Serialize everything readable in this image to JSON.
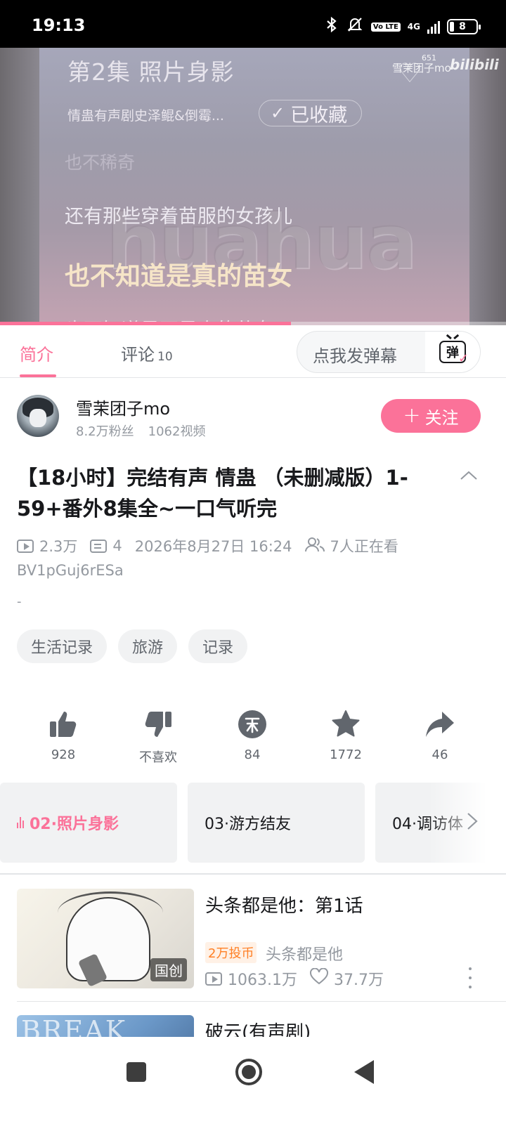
{
  "status_bar": {
    "time": "19:13",
    "icons": [
      "bluetooth-icon",
      "mute-icon",
      "volte-icon",
      "4g-icon",
      "signal-icon",
      "battery-icon"
    ],
    "volte": "Vo LTE",
    "network": "4G",
    "battery": "8"
  },
  "player": {
    "episode_title": "第2集 照片身影",
    "series_name": "情蛊有声剧史泽鲲&倒霉...",
    "favorite_label": "已收藏",
    "watermark_user": "雪茉团子mo",
    "watermark_logo": "bilibili",
    "watermark_count": "651",
    "lyric_prev2": "也不稀奇",
    "lyric_prev1": "还有那些穿着苗服的女孩儿",
    "lyric_current": "也不知道是真的苗女",
    "lyric_next": "也不知道是不是真的苗女",
    "overlay_text": "huahua",
    "progress_fraction": 0.575
  },
  "tabs": {
    "intro": "简介",
    "comments": "评论",
    "comments_count": "10",
    "danmaku_placeholder": "点我发弹幕",
    "danmaku_icon_text": "弹"
  },
  "uploader": {
    "name": "雪茉团子mo",
    "fans": "8.2万粉丝",
    "videos": "1062视频",
    "follow_label": "关注"
  },
  "video": {
    "title": "【18小时】完结有声 情蛊 （未删减版）1-59+番外8集全~一口气听完",
    "views": "2.3万",
    "danmaku_count": "4",
    "date": "2026年8月27日 16:24",
    "watching": "7人正在看",
    "bvid": "BV1pGuj6rESa",
    "description": "-",
    "tags": [
      "生活记录",
      "旅游",
      "记录"
    ]
  },
  "actions": {
    "like": "928",
    "dislike": "不喜欢",
    "coin": "84",
    "favorite": "1772",
    "share": "46"
  },
  "episodes": [
    {
      "label": "02·照片身影",
      "current": true
    },
    {
      "label": "03·游方结友",
      "current": false
    },
    {
      "label": "04·调访体",
      "current": false
    }
  ],
  "recommendations": [
    {
      "title": "头条都是他：第1话",
      "badge": "国创",
      "coin_tag": "2万投币",
      "author": "头条都是他",
      "views": "1063.1万",
      "likes": "37.7万"
    },
    {
      "title": "破云(有声剧)",
      "thumb_text": "BREAK"
    }
  ],
  "colors": {
    "accent": "#fb7299",
    "text_primary": "#18191c",
    "text_secondary": "#9499a0"
  }
}
